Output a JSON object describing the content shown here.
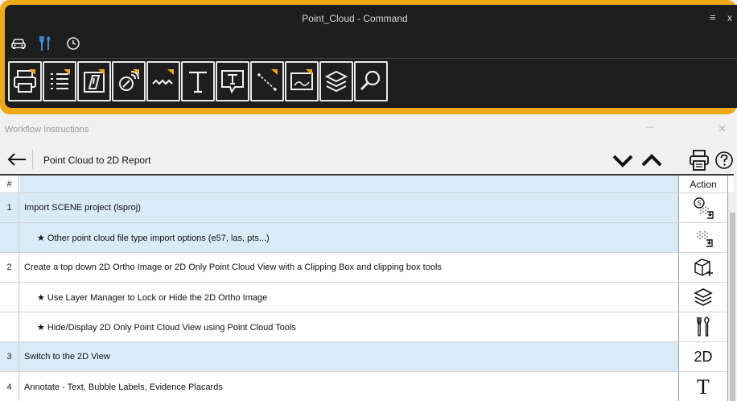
{
  "command_window": {
    "title": "Point_Cloud - Command",
    "menu_glyph": "≡",
    "close_glyph": "x",
    "tabs": [
      {
        "icon": "car-icon"
      },
      {
        "icon": "tools-icon",
        "active": true
      },
      {
        "icon": "clock-icon"
      }
    ],
    "tools": [
      {
        "icon": "printer-icon"
      },
      {
        "icon": "list-icon"
      },
      {
        "icon": "placard-icon"
      },
      {
        "icon": "scanner-icon"
      },
      {
        "icon": "wave-line-icon"
      },
      {
        "icon": "text-icon",
        "glyph": "T"
      },
      {
        "icon": "callout-text-icon",
        "glyph": "T"
      },
      {
        "icon": "measure-line-icon"
      },
      {
        "icon": "image-icon"
      },
      {
        "icon": "layers-icon"
      },
      {
        "icon": "search-icon"
      }
    ],
    "colors": {
      "frame": "#f0a916",
      "background": "#1e1e1e",
      "active_tab": "#3b8fd9"
    }
  },
  "workflow": {
    "panel_title": "Workflow Instructions",
    "minimize_glyph": "—",
    "close_glyph": "✕",
    "name": "Point Cloud to 2D Report",
    "table": {
      "headers": {
        "number": "#",
        "step": "",
        "action": "Action"
      },
      "rows": [
        {
          "num": "1",
          "text": "Import SCENE project (lsproj)",
          "indent": false,
          "shade": "blue",
          "action_icon": "scene-import-icon"
        },
        {
          "num": "",
          "text": "★ Other point cloud file type import options (e57, las, pts...)",
          "indent": true,
          "shade": "blue",
          "action_icon": "point-cloud-import-icon"
        },
        {
          "num": "2",
          "text": "Create a top down 2D Ortho Image or 2D Only Point Cloud View with a Clipping Box and clipping box tools",
          "indent": false,
          "shade": "white",
          "action_icon": "clipping-box-icon"
        },
        {
          "num": "",
          "text": "★ Use Layer Manager to Lock or Hide the 2D Ortho Image",
          "indent": true,
          "shade": "white",
          "action_icon": "layers-icon"
        },
        {
          "num": "",
          "text": "★ Hide/Display 2D Only Point Cloud View using Point Cloud Tools",
          "indent": true,
          "shade": "white",
          "action_icon": "tools-icon"
        },
        {
          "num": "3",
          "text": "Switch to the 2D View",
          "indent": false,
          "shade": "blue",
          "action_icon": "2d-view-icon",
          "action_text": "2D"
        },
        {
          "num": "4",
          "text": "Annotate - Text, Bubble Labels, Evidence Placards",
          "indent": false,
          "shade": "white",
          "action_icon": "text-icon",
          "action_text": "T"
        }
      ]
    }
  }
}
